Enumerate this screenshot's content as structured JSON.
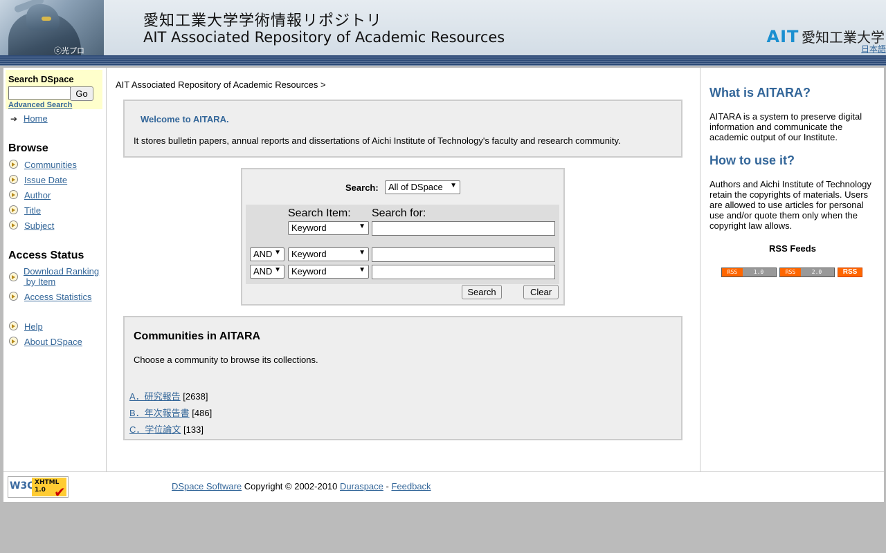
{
  "header": {
    "logo_copyright": "ⓒ光プロ",
    "title_jp": "愛知工業大学学術情報リポジトリ",
    "title_en": "AIT Associated Repository of Academic Resources",
    "brand_ait": "AIT",
    "brand_univ": "愛知工業大学",
    "lang_link": "日本語"
  },
  "sidebar": {
    "search_label": "Search DSpace",
    "search_value": "",
    "go_label": "Go",
    "advanced_label": "Advanced Search",
    "home_label": "Home",
    "browse_heading": "Browse",
    "browse_items": [
      "Communities",
      "Issue Date",
      "Author",
      "Title",
      "Subject"
    ],
    "access_heading": "Access Status",
    "download_ranking_1": "Download Ranking",
    "download_ranking_2": " by Item",
    "access_statistics": "Access Statistics",
    "help_label": "Help",
    "about_label": "About DSpace"
  },
  "main": {
    "breadcrumb": "AIT Associated Repository of Academic Resources >",
    "welcome_heading": "Welcome to AITARA.",
    "welcome_text": "It stores bulletin papers, annual reports and dissertations of Aichi Institute of Technology's faculty and research community.",
    "search": {
      "scope_label": "Search:",
      "scope_value": "All of DSpace",
      "item_header": "Search Item:",
      "for_header": "Search for:",
      "rows": [
        {
          "conj": "",
          "field": "Keyword",
          "value": ""
        },
        {
          "conj": "AND",
          "field": "Keyword",
          "value": ""
        },
        {
          "conj": "AND",
          "field": "Keyword",
          "value": ""
        }
      ],
      "search_button": "Search",
      "clear_button": "Clear"
    },
    "communities": {
      "heading": "Communities in AITARA",
      "intro": "Choose a community to browse its collections.",
      "items": [
        {
          "name": "A．研究報告",
          "count": "[2638]"
        },
        {
          "name": "B．年次報告書",
          "count": "[486]"
        },
        {
          "name": "C．学位論文",
          "count": "[133]"
        }
      ]
    }
  },
  "right": {
    "what_heading": "What is AITARA?",
    "what_text": "AITARA is a system to preserve digital information and communicate the academic output of our Institute.",
    "how_heading": "How to use it?",
    "how_text": "Authors and Aichi Institute of Technology retain the copyrights of materials. Users are allowed to use articles for personal use and/or quote them only when the copyright law allows.",
    "rss_label": "RSS Feeds",
    "rss_badges": [
      {
        "left": "RSS",
        "right": "1.0"
      },
      {
        "left": "RSS",
        "right": "2.0"
      },
      {
        "label": "RSS"
      }
    ]
  },
  "footer": {
    "w3c_text": "W3C",
    "xhtml_text_1": "XHTML",
    "xhtml_text_2": "1.0",
    "dspace_link": "DSpace Software",
    "copyright": " Copyright © 2002-2010 ",
    "duraspace_link": "Duraspace",
    "separator": " - ",
    "feedback_link": "Feedback"
  },
  "colors": {
    "accent": "#336699",
    "search_box_bg": "#ffffcc",
    "panel_bg": "#eeeeee",
    "page_bg": "#bbbbbb"
  }
}
